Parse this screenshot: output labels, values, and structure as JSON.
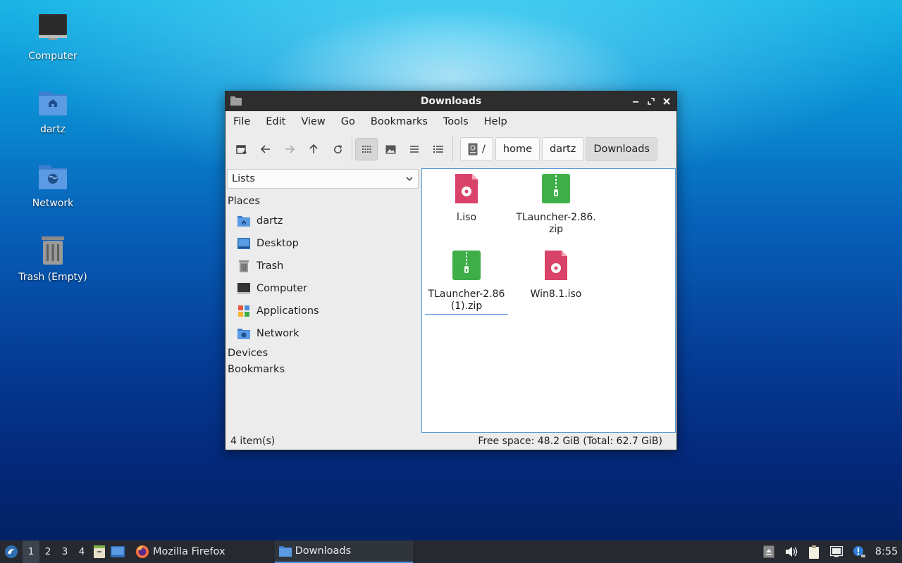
{
  "desktop": {
    "icons": [
      {
        "label": "Computer"
      },
      {
        "label": "dartz"
      },
      {
        "label": "Network"
      },
      {
        "label": "Trash (Empty)"
      }
    ]
  },
  "window": {
    "title": "Downloads",
    "menu": [
      "File",
      "Edit",
      "View",
      "Go",
      "Bookmarks",
      "Tools",
      "Help"
    ],
    "pathbar": [
      "/",
      "home",
      "dartz",
      "Downloads"
    ],
    "sidebar": {
      "select_value": "Lists",
      "places_heading": "Places",
      "places": [
        {
          "label": "dartz",
          "icon": "home-folder-icon"
        },
        {
          "label": "Desktop",
          "icon": "desktop-icon"
        },
        {
          "label": "Trash",
          "icon": "trash-icon"
        },
        {
          "label": "Computer",
          "icon": "computer-icon"
        },
        {
          "label": "Applications",
          "icon": "applications-icon"
        },
        {
          "label": "Network",
          "icon": "network-folder-icon"
        }
      ],
      "devices_heading": "Devices",
      "bookmarks_heading": "Bookmarks"
    },
    "files": [
      {
        "name": "l.iso",
        "type": "iso"
      },
      {
        "name": "TLauncher-2.86.zip",
        "type": "zip"
      },
      {
        "name": "TLauncher-2.86(1).zip",
        "type": "zip"
      },
      {
        "name": "Win8.1.iso",
        "type": "iso"
      }
    ],
    "status": {
      "items": "4 item(s)",
      "free_space": "Free space: 48.2 GiB (Total: 62.7 GiB)"
    }
  },
  "taskbar": {
    "workspaces": [
      "1",
      "2",
      "3",
      "4"
    ],
    "tasks": [
      {
        "label": "Mozilla Firefox"
      },
      {
        "label": "Downloads"
      }
    ],
    "clock": "8:55"
  },
  "colors": {
    "accent": "#4a90d9",
    "iso_icon": "#d9436a",
    "zip_icon": "#3fae49",
    "folder": "#4a8fd8"
  }
}
